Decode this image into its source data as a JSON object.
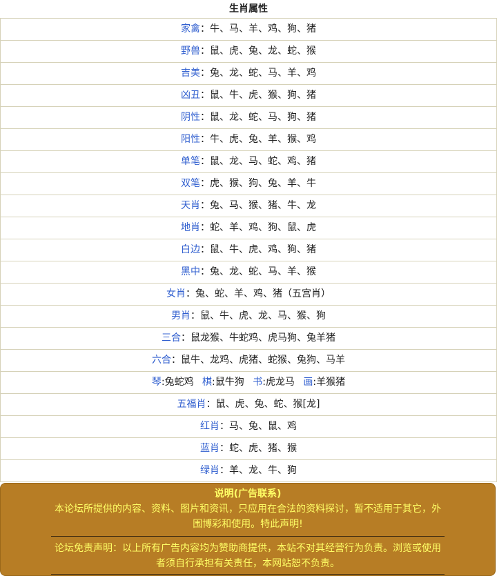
{
  "title": "生肖属性",
  "rows": [
    {
      "label": "家禽",
      "value": "牛、马、羊、鸡、狗、猪"
    },
    {
      "label": "野兽",
      "value": "鼠、虎、兔、龙、蛇、猴"
    },
    {
      "label": "吉美",
      "value": "兔、龙、蛇、马、羊、鸡"
    },
    {
      "label": "凶丑",
      "value": "鼠、牛、虎、猴、狗、猪"
    },
    {
      "label": "阴性",
      "value": "鼠、龙、蛇、马、狗、猪"
    },
    {
      "label": "阳性",
      "value": "牛、虎、兔、羊、猴、鸡"
    },
    {
      "label": "单笔",
      "value": "鼠、龙、马、蛇、鸡、猪"
    },
    {
      "label": "双笔",
      "value": "虎、猴、狗、兔、羊、牛"
    },
    {
      "label": "天肖",
      "value": "兔、马、猴、猪、牛、龙"
    },
    {
      "label": "地肖",
      "value": "蛇、羊、鸡、狗、鼠、虎"
    },
    {
      "label": "白边",
      "value": "鼠、牛、虎、鸡、狗、猪"
    },
    {
      "label": "黑中",
      "value": "兔、龙、蛇、马、羊、猴"
    },
    {
      "label": "女肖",
      "value": "兔、蛇、羊、鸡、猪（五宫肖）"
    },
    {
      "label": "男肖",
      "value": "鼠、牛、虎、龙、马、猴、狗"
    },
    {
      "label": "三合",
      "value": "鼠龙猴、牛蛇鸡、虎马狗、兔羊猪"
    },
    {
      "label": "六合",
      "value": "鼠牛、龙鸡、虎猪、蛇猴、兔狗、马羊"
    }
  ],
  "mixed_row": [
    {
      "label": "琴",
      "value": "兔蛇鸡"
    },
    {
      "label": "棋",
      "value": "鼠牛狗"
    },
    {
      "label": "书",
      "value": "虎龙马"
    },
    {
      "label": "画",
      "value": "羊猴猪"
    }
  ],
  "rows_after": [
    {
      "label": "五福肖",
      "value": "鼠、虎、兔、蛇、猴[龙]"
    },
    {
      "label": "红肖",
      "value": "马、兔、鼠、鸡"
    },
    {
      "label": "蓝肖",
      "value": "蛇、虎、猪、猴"
    },
    {
      "label": "绿肖",
      "value": "羊、龙、牛、狗"
    }
  ],
  "notice": {
    "title": "说明(广告联系)",
    "text1": "本论坛所提供的内容、资料、图片和资讯，只应用在合法的资料探讨，暂不适用于其它，外围博彩和使用。特此声明!",
    "text2": "论坛免责声明：以上所有广告内容均为赞助商提供，本站不对其经营行为负责。浏览或使用者须自行承担有关责任，本网站恕不负责。"
  },
  "colors": {
    "label": "#2f5ecf",
    "notice_bg": "#b77d25",
    "notice_text": "#ffff66"
  }
}
